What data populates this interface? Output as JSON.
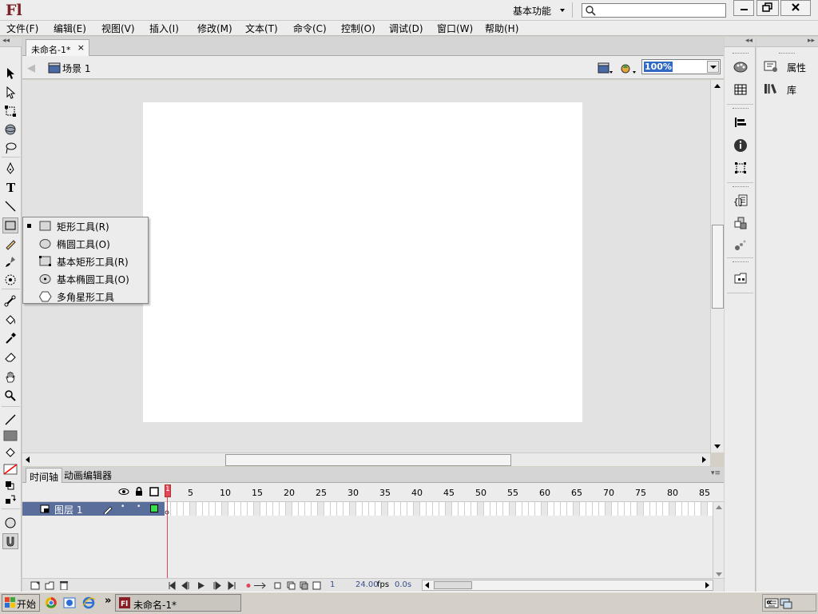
{
  "app": {
    "logo": "Fl",
    "workspace": "基本功能",
    "search_placeholder": ""
  },
  "menu": [
    "文件(F)",
    "编辑(E)",
    "视图(V)",
    "插入(I)",
    "修改(M)",
    "文本(T)",
    "命令(C)",
    "控制(O)",
    "调试(D)",
    "窗口(W)",
    "帮助(H)"
  ],
  "document": {
    "tab_title": "未命名-1*",
    "close_glyph": "×",
    "scene": "场景 1",
    "zoom": "100%"
  },
  "tool_flyout": {
    "items": [
      {
        "label": "矩形工具(R)",
        "icon": "rectangle-icon",
        "selected": true
      },
      {
        "label": "椭圆工具(O)",
        "icon": "oval-icon",
        "selected": false
      },
      {
        "label": "基本矩形工具(R)",
        "icon": "primitive-rectangle-icon",
        "selected": false
      },
      {
        "label": "基本椭圆工具(O)",
        "icon": "primitive-oval-icon",
        "selected": false
      },
      {
        "label": "多角星形工具",
        "icon": "polystar-icon",
        "selected": false
      }
    ]
  },
  "timeline": {
    "tab": "时间轴",
    "motion_tab": "动画编辑器",
    "layer_name": "图层 1",
    "frame_numbers": [
      "1",
      "5",
      "10",
      "15",
      "20",
      "25",
      "30",
      "35",
      "40",
      "45",
      "50",
      "55",
      "60",
      "65",
      "70",
      "75",
      "80",
      "85"
    ],
    "current_frame": "1",
    "fps": "24.00",
    "fps_unit": "fps",
    "elapsed": "0.0s"
  },
  "panels": {
    "properties": "属性",
    "library": "库"
  },
  "taskbar": {
    "start": "开始",
    "task": "未命名-1*"
  },
  "colors": {
    "accent": "#596e9a",
    "playhead": "#e4455a",
    "logo": "#7a2228",
    "fill": "#7f7f7f",
    "stroke": "#ff0000"
  }
}
